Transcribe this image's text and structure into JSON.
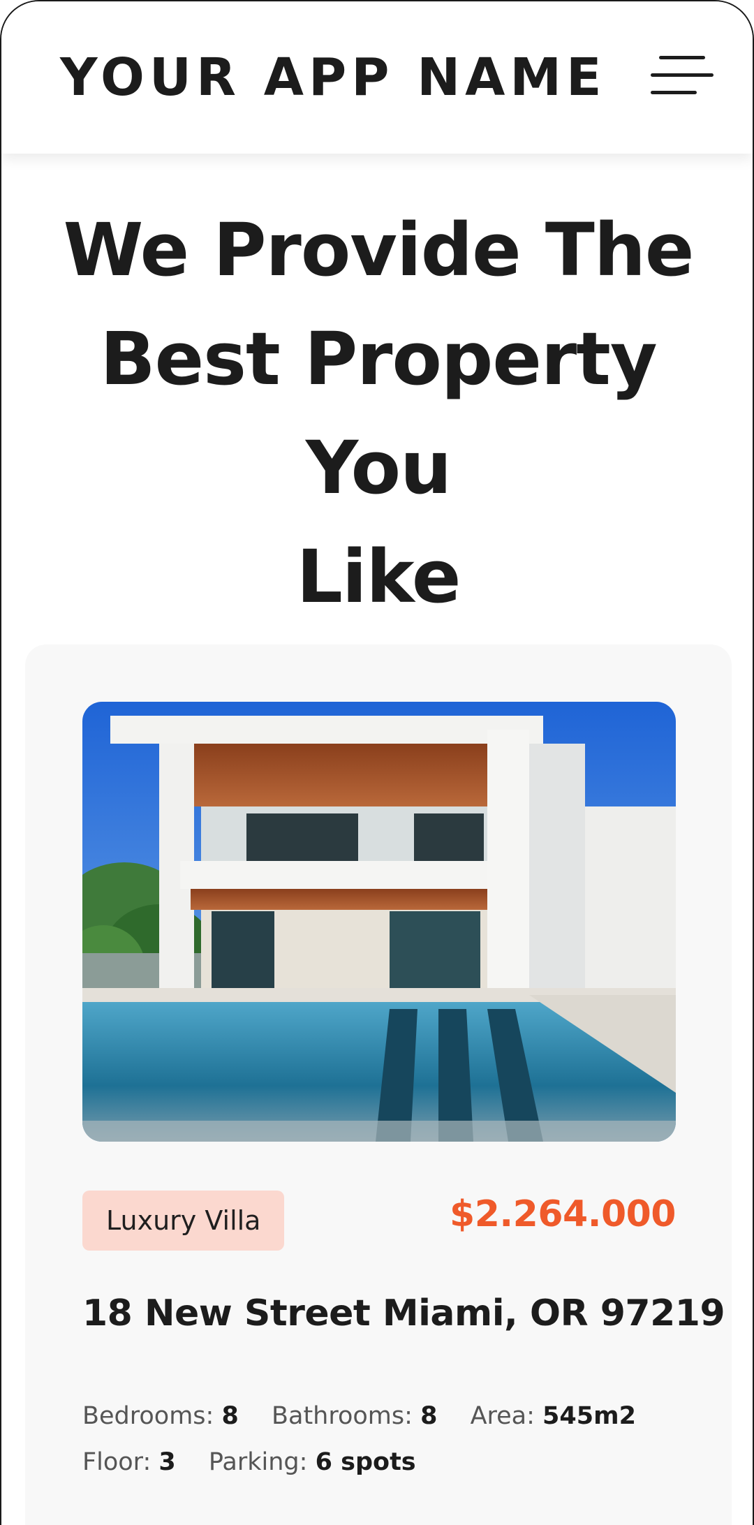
{
  "header": {
    "app_name": "YOUR APP NAME",
    "menu_icon": "hamburger-menu-icon"
  },
  "hero": {
    "title_line1": "We Provide The",
    "title_line2": "Best Property You",
    "title_line3": "Like"
  },
  "listing": {
    "image": "modern-villa-with-pool-photo",
    "category": "Luxury Villa",
    "price": "$2.264.000",
    "address": "18 New Street Miami, OR 97219",
    "specs": [
      {
        "label": "Bedrooms:",
        "value": "8"
      },
      {
        "label": "Bathrooms:",
        "value": "8"
      },
      {
        "label": "Area:",
        "value": "545m2"
      },
      {
        "label": "Floor:",
        "value": "3"
      },
      {
        "label": "Parking:",
        "value": "6 spots"
      }
    ]
  },
  "colors": {
    "accent": "#ef5a2a",
    "badge_bg": "#fbd8cf",
    "card_bg": "#f8f8f8",
    "text": "#1c1c1c"
  }
}
